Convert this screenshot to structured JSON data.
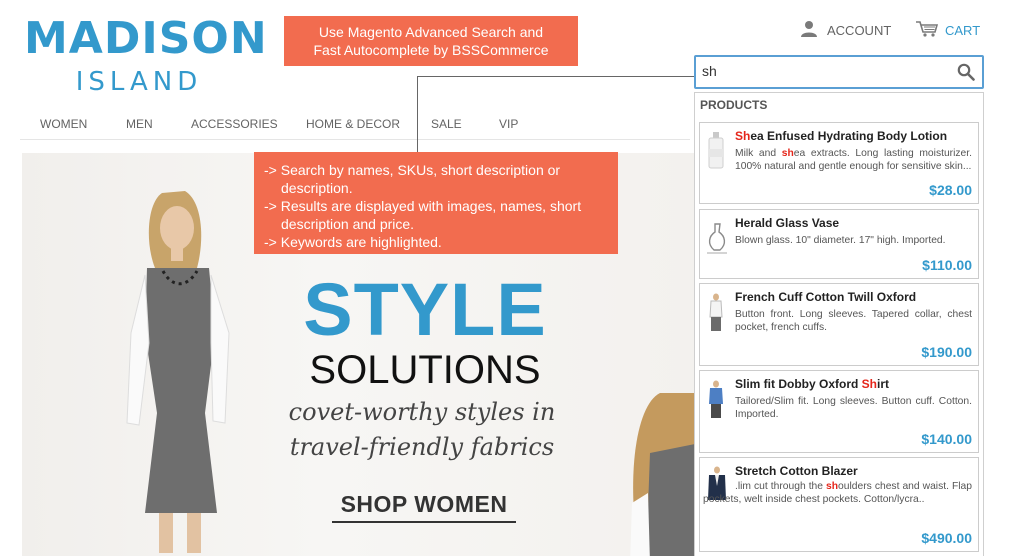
{
  "logo": {
    "main": "MADISON",
    "sub": "ISLAND"
  },
  "callout_top": {
    "line1": "Use Magento Advanced Search and",
    "line2": "Fast Autocomplete by BSSCommerce"
  },
  "header": {
    "account_label": "ACCOUNT",
    "cart_label": "CART"
  },
  "nav": {
    "items": [
      "WOMEN",
      "MEN",
      "ACCESSORIES",
      "HOME & DECOR",
      "SALE",
      "VIP"
    ]
  },
  "search": {
    "value": "sh",
    "placeholder": ""
  },
  "callout_mid": {
    "l1": "-> Search by names, SKUs, short description or",
    "l2": "description.",
    "l3": "-> Results are displayed with images, names, short",
    "l4": "description and price.",
    "l5": "-> Keywords are highlighted."
  },
  "banner": {
    "title": "STYLE",
    "subtitle": "SOLUTIONS",
    "tagline1": "covet-worthy styles in",
    "tagline2": "travel-friendly fabrics",
    "cta": "SHOP WOMEN"
  },
  "dropdown": {
    "heading": "PRODUCTS",
    "results": [
      {
        "name_hl": "Sh",
        "name_rest": "ea Enfused Hydrating Body Lotion",
        "desc_pre": "Milk and ",
        "desc_hl": "sh",
        "desc_post": "ea extracts. Long lasting moisturizer. 100% natural and gentle enough for sensitive skin...",
        "price": "$28.00",
        "icon": "lotion-bottle-icon"
      },
      {
        "name_hl": "",
        "name_rest": "Herald Glass Vase",
        "desc_pre": "Blown glass. 10\" diameter. 17\" high. Imported.",
        "desc_hl": "",
        "desc_post": "",
        "price": "$110.00",
        "icon": "glass-vase-icon"
      },
      {
        "name_hl": "",
        "name_rest": "French Cuff Cotton Twill Oxford",
        "desc_pre": "Button front. Long sleeves. Tapered collar, chest pocket, french cuffs.",
        "desc_hl": "",
        "desc_post": "",
        "price": "$190.00",
        "icon": "oxford-shirt-icon"
      },
      {
        "name_pre": "Slim fit Dobby Oxford ",
        "name_hl": "Sh",
        "name_rest": "irt",
        "desc_pre": "Tailored/Slim fit. Long sleeves. Button cuff. Cotton. Imported.",
        "desc_hl": "",
        "desc_post": "",
        "price": "$140.00",
        "icon": "dobby-shirt-icon"
      },
      {
        "name_hl": "",
        "name_rest": "Stretch Cotton Blazer",
        "desc_pre": ".lim cut through the ",
        "desc_hl": "sh",
        "desc_post": "oulders chest and waist. Flap pockets, welt inside chest pockets. Cotton/lycra..",
        "price": "$490.00",
        "icon": "blazer-icon"
      }
    ]
  },
  "colors": {
    "brand_blue": "#3399cc",
    "callout": "#f26c4f",
    "highlight": "#e5261b"
  }
}
